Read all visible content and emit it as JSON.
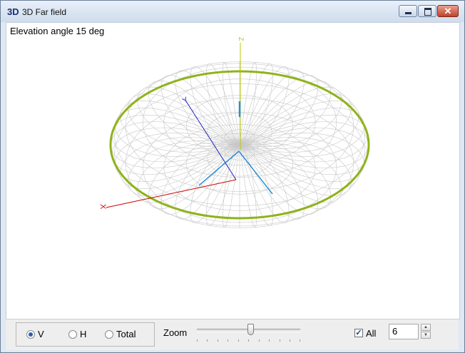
{
  "window": {
    "title": "3D Far field",
    "app_icon": "3D"
  },
  "controls": {
    "minimize": "minimize-icon",
    "maximize": "maximize-icon",
    "close": "close-icon"
  },
  "plot": {
    "elevation_text": "Elevation angle 15 deg",
    "axis_labels": {
      "x": "X",
      "y": "Y",
      "z": "Z"
    }
  },
  "colors": {
    "pattern_mesh": "#c8c8c8",
    "horizon_ring": "#8fb31a",
    "x_axis": "#cc0000",
    "y_axis": "#1f1fbf",
    "z_axis": "#b5c800",
    "field_arrows": "#2a8fd6"
  },
  "polarization": {
    "options": [
      "V",
      "H",
      "Total"
    ],
    "selected": "V"
  },
  "zoom": {
    "label": "Zoom",
    "position": 0.52
  },
  "all": {
    "label": "All",
    "checked": true
  },
  "spinner": {
    "value": "6"
  }
}
